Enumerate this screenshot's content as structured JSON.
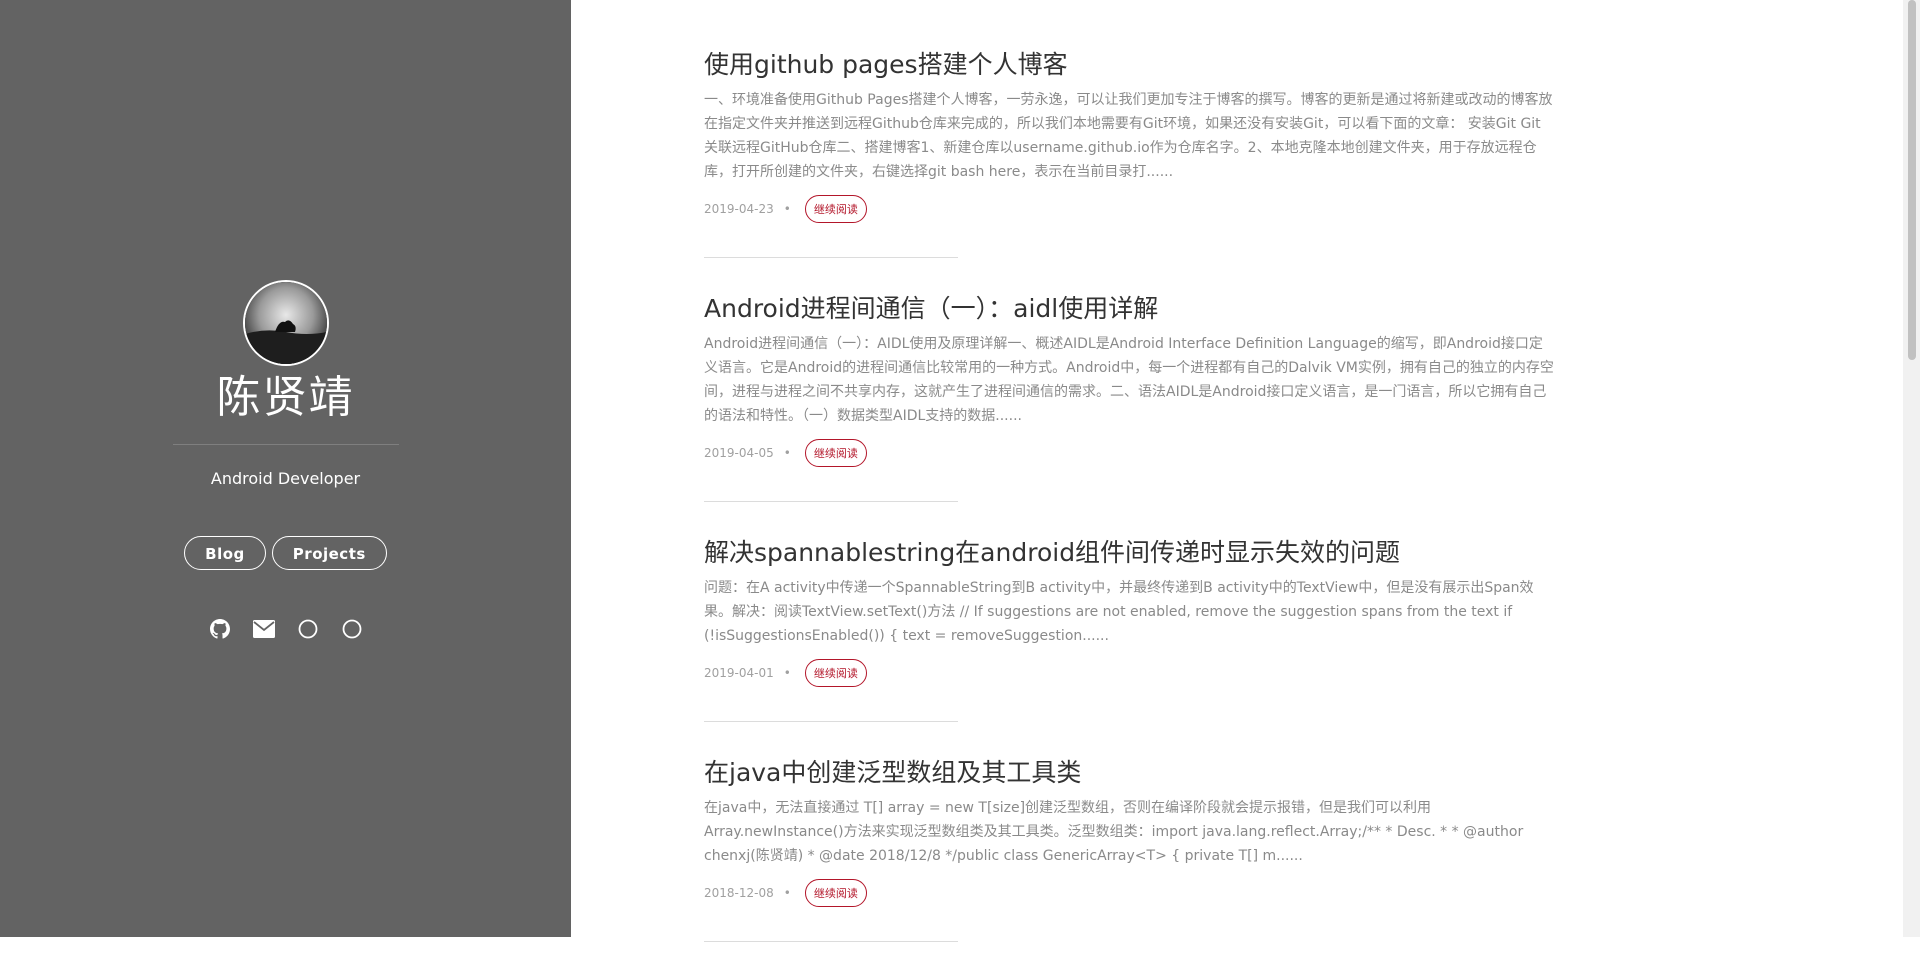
{
  "sidebar": {
    "author_name": "陈贤靖",
    "subtitle": "Android Developer",
    "nav": [
      {
        "label": "Blog"
      },
      {
        "label": "Projects"
      }
    ],
    "socials": [
      {
        "icon": "github-icon"
      },
      {
        "icon": "envelope-icon"
      },
      {
        "icon": "circle-icon"
      },
      {
        "icon": "circle-icon"
      }
    ],
    "background_color": "#636363"
  },
  "posts": [
    {
      "title": "使用github pages搭建个人博客",
      "excerpt": "一、环境准备使用Github Pages搭建个人博客，一劳永逸，可以让我们更加专注于博客的撰写。博客的更新是通过将新建或改动的博客放在指定文件夹并推送到远程Github仓库来完成的，所以我们本地需要有Git环境，如果还没有安装Git，可以看下面的文章： 安装Git Git关联远程GitHub仓库二、搭建博客1、新建仓库以username.github.io作为仓库名字。2、本地克隆本地创建文件夹，用于存放远程仓库，打开所创建的文件夹，右键选择git bash here，表示在当前目录打......",
      "date": "2019-04-23",
      "dot": "•",
      "read_more": "继续阅读"
    },
    {
      "title": "Android进程间通信（一）：aidl使用详解",
      "excerpt": "Android进程间通信（一）：AIDL使用及原理详解一、概述AIDL是Android Interface Definition Language的缩写，即Android接口定义语言。它是Android的进程间通信比较常用的一种方式。Android中，每一个进程都有自己的Dalvik VM实例，拥有自己的独立的内存空间，进程与进程之间不共享内存，这就产生了进程间通信的需求。二、语法AIDL是Android接口定义语言，是一门语言，所以它拥有自己的语法和特性。（一）数据类型AIDL支持的数据......",
      "date": "2019-04-05",
      "dot": "•",
      "read_more": "继续阅读"
    },
    {
      "title": "解决spannablestring在android组件间传递时显示失效的问题",
      "excerpt": "问题：在A activity中传递一个SpannableString到B activity中，并最终传递到B activity中的TextView中，但是没有展示出Span效果。解决：阅读TextView.setText()方法 // If suggestions are not enabled, remove the suggestion spans from the text if (!isSuggestionsEnabled()) { text = removeSuggestion......",
      "date": "2019-04-01",
      "dot": "•",
      "read_more": "继续阅读"
    },
    {
      "title": "在java中创建泛型数组及其工具类",
      "excerpt": "在java中，无法直接通过 T[] array = new T[size]创建泛型数组，否则在编译阶段就会提示报错，但是我们可以利用Array.newInstance()方法来实现泛型数组类及其工具类。泛型数组类：import java.lang.reflect.Array;/** * Desc. * * @author chenxj(陈贤靖) * @date 2018/12/8 */public class GenericArray<T> { private T[] m......",
      "date": "2018-12-08",
      "dot": "•",
      "read_more": "继续阅读"
    }
  ],
  "colors": {
    "accent": "#b3162a",
    "title": "#333333",
    "excerpt": "#8a8a8a"
  }
}
